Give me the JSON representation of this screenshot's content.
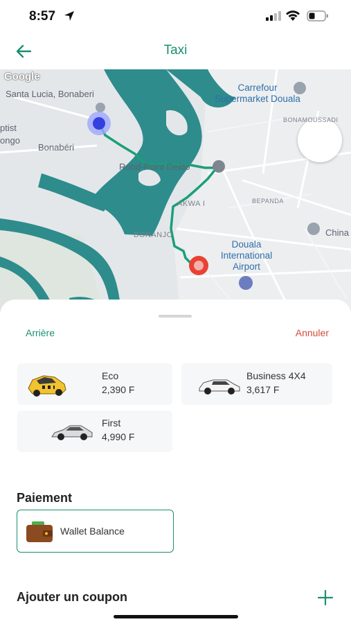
{
  "status_bar": {
    "time": "8:57"
  },
  "header": {
    "title": "Taxi"
  },
  "map": {
    "attribution": "Google",
    "labels": {
      "santa_lucia": "Santa Lucia, Bonaberi",
      "carrefour_line1": "Carrefour",
      "carrefour_line2": "Supermarket Douala",
      "bonamoussadi": "BONAMOUSSADI",
      "ptist": "ptist",
      "ongo": "ongo",
      "bonaberi": "Bonabéri",
      "rond_point": "Rond-Point Deido",
      "akwa": "AKWA I",
      "bepanda": "BEPANDA",
      "bonanjo": "BONANJO",
      "airport_line1": "Douala",
      "airport_line2": "International",
      "airport_line3": "Airport",
      "china": "China"
    }
  },
  "sheet": {
    "back_label": "Arrière",
    "cancel_label": "Annuler",
    "vehicles": [
      {
        "name": "Eco",
        "price": "2,390 F",
        "icon": "yellow-taxi-icon"
      },
      {
        "name": "Business 4X4",
        "price": "3,617 F",
        "icon": "white-suv-icon"
      },
      {
        "name": "First",
        "price": "4,990 F",
        "icon": "silver-sedan-icon"
      }
    ],
    "payment": {
      "title": "Paiement",
      "method": "Wallet Balance",
      "icon": "wallet-icon"
    },
    "coupon": {
      "title": "Ajouter un coupon",
      "icon": "plus-icon"
    }
  },
  "colors": {
    "accent": "#1a8f6f",
    "danger": "#d24b3d",
    "water": "#2f8f8f",
    "route": "#1a9f7a"
  }
}
